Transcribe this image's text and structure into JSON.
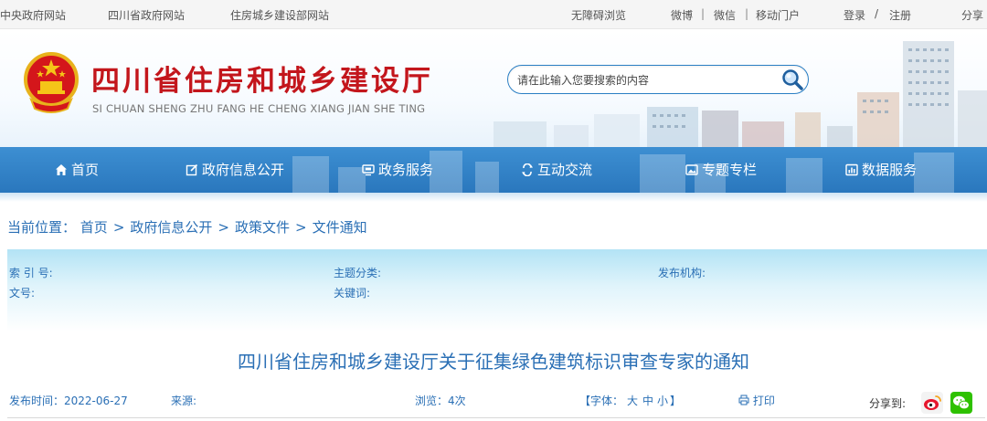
{
  "topbar": {
    "links_left": [
      "中央政府网站",
      "四川省政府网站",
      "住房城乡建设部网站"
    ],
    "accessibility": "无障碍浏览",
    "weibo": "微博",
    "wechat": "微信",
    "mobile": "移动门户",
    "sep": "|",
    "login": "登录",
    "slash": "/",
    "register": "注册",
    "share": "分享"
  },
  "header": {
    "title": "四川省住房和城乡建设厅",
    "subtitle": "SI CHUAN SHENG ZHU FANG HE CHENG XIANG JIAN SHE TING",
    "search_placeholder": "请在此输入您要搜索的内容"
  },
  "nav": {
    "items": [
      {
        "label": "首页",
        "icon": "home-icon"
      },
      {
        "label": "政府信息公开",
        "icon": "edit-icon"
      },
      {
        "label": "政务服务",
        "icon": "screen-icon"
      },
      {
        "label": "互动交流",
        "icon": "interact-icon"
      },
      {
        "label": "专题专栏",
        "icon": "image-icon"
      },
      {
        "label": "数据服务",
        "icon": "data-icon"
      }
    ]
  },
  "breadcrumb": {
    "prefix": "当前位置：",
    "items": [
      "首页",
      "政府信息公开",
      "政策文件",
      "文件通知"
    ],
    "arrow": ">"
  },
  "meta": {
    "index_label": "索 引 号:",
    "topic_label": "主题分类:",
    "publisher_label": "发布机构:",
    "doc_no_label": "文号:",
    "keywords_label": "关键词:"
  },
  "article": {
    "title": "四川省住房和城乡建设厅关于征集绿色建筑标识审查专家的通知",
    "publish_time": "发布时间：2022-06-27",
    "source_label": "来源:",
    "views": "浏览：4次",
    "font_prefix": "【字体：",
    "font_large": "大",
    "font_medium": "中",
    "font_small": "小",
    "font_suffix": "】",
    "print": "打印",
    "share_to": "分享到:"
  },
  "colors": {
    "brand_red": "#c3161c",
    "nav_blue": "#2a77bd",
    "link_blue": "#2a6fb5"
  }
}
